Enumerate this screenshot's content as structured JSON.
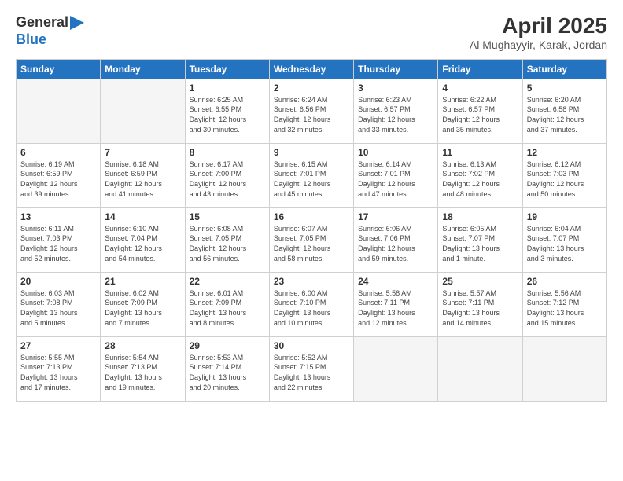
{
  "logo": {
    "line1": "General",
    "line2": "Blue"
  },
  "title": "April 2025",
  "subtitle": "Al Mughayyir, Karak, Jordan",
  "days_header": [
    "Sunday",
    "Monday",
    "Tuesday",
    "Wednesday",
    "Thursday",
    "Friday",
    "Saturday"
  ],
  "weeks": [
    [
      {
        "num": "",
        "info": ""
      },
      {
        "num": "",
        "info": ""
      },
      {
        "num": "1",
        "info": "Sunrise: 6:25 AM\nSunset: 6:55 PM\nDaylight: 12 hours\nand 30 minutes."
      },
      {
        "num": "2",
        "info": "Sunrise: 6:24 AM\nSunset: 6:56 PM\nDaylight: 12 hours\nand 32 minutes."
      },
      {
        "num": "3",
        "info": "Sunrise: 6:23 AM\nSunset: 6:57 PM\nDaylight: 12 hours\nand 33 minutes."
      },
      {
        "num": "4",
        "info": "Sunrise: 6:22 AM\nSunset: 6:57 PM\nDaylight: 12 hours\nand 35 minutes."
      },
      {
        "num": "5",
        "info": "Sunrise: 6:20 AM\nSunset: 6:58 PM\nDaylight: 12 hours\nand 37 minutes."
      }
    ],
    [
      {
        "num": "6",
        "info": "Sunrise: 6:19 AM\nSunset: 6:59 PM\nDaylight: 12 hours\nand 39 minutes."
      },
      {
        "num": "7",
        "info": "Sunrise: 6:18 AM\nSunset: 6:59 PM\nDaylight: 12 hours\nand 41 minutes."
      },
      {
        "num": "8",
        "info": "Sunrise: 6:17 AM\nSunset: 7:00 PM\nDaylight: 12 hours\nand 43 minutes."
      },
      {
        "num": "9",
        "info": "Sunrise: 6:15 AM\nSunset: 7:01 PM\nDaylight: 12 hours\nand 45 minutes."
      },
      {
        "num": "10",
        "info": "Sunrise: 6:14 AM\nSunset: 7:01 PM\nDaylight: 12 hours\nand 47 minutes."
      },
      {
        "num": "11",
        "info": "Sunrise: 6:13 AM\nSunset: 7:02 PM\nDaylight: 12 hours\nand 48 minutes."
      },
      {
        "num": "12",
        "info": "Sunrise: 6:12 AM\nSunset: 7:03 PM\nDaylight: 12 hours\nand 50 minutes."
      }
    ],
    [
      {
        "num": "13",
        "info": "Sunrise: 6:11 AM\nSunset: 7:03 PM\nDaylight: 12 hours\nand 52 minutes."
      },
      {
        "num": "14",
        "info": "Sunrise: 6:10 AM\nSunset: 7:04 PM\nDaylight: 12 hours\nand 54 minutes."
      },
      {
        "num": "15",
        "info": "Sunrise: 6:08 AM\nSunset: 7:05 PM\nDaylight: 12 hours\nand 56 minutes."
      },
      {
        "num": "16",
        "info": "Sunrise: 6:07 AM\nSunset: 7:05 PM\nDaylight: 12 hours\nand 58 minutes."
      },
      {
        "num": "17",
        "info": "Sunrise: 6:06 AM\nSunset: 7:06 PM\nDaylight: 12 hours\nand 59 minutes."
      },
      {
        "num": "18",
        "info": "Sunrise: 6:05 AM\nSunset: 7:07 PM\nDaylight: 13 hours\nand 1 minute."
      },
      {
        "num": "19",
        "info": "Sunrise: 6:04 AM\nSunset: 7:07 PM\nDaylight: 13 hours\nand 3 minutes."
      }
    ],
    [
      {
        "num": "20",
        "info": "Sunrise: 6:03 AM\nSunset: 7:08 PM\nDaylight: 13 hours\nand 5 minutes."
      },
      {
        "num": "21",
        "info": "Sunrise: 6:02 AM\nSunset: 7:09 PM\nDaylight: 13 hours\nand 7 minutes."
      },
      {
        "num": "22",
        "info": "Sunrise: 6:01 AM\nSunset: 7:09 PM\nDaylight: 13 hours\nand 8 minutes."
      },
      {
        "num": "23",
        "info": "Sunrise: 6:00 AM\nSunset: 7:10 PM\nDaylight: 13 hours\nand 10 minutes."
      },
      {
        "num": "24",
        "info": "Sunrise: 5:58 AM\nSunset: 7:11 PM\nDaylight: 13 hours\nand 12 minutes."
      },
      {
        "num": "25",
        "info": "Sunrise: 5:57 AM\nSunset: 7:11 PM\nDaylight: 13 hours\nand 14 minutes."
      },
      {
        "num": "26",
        "info": "Sunrise: 5:56 AM\nSunset: 7:12 PM\nDaylight: 13 hours\nand 15 minutes."
      }
    ],
    [
      {
        "num": "27",
        "info": "Sunrise: 5:55 AM\nSunset: 7:13 PM\nDaylight: 13 hours\nand 17 minutes."
      },
      {
        "num": "28",
        "info": "Sunrise: 5:54 AM\nSunset: 7:13 PM\nDaylight: 13 hours\nand 19 minutes."
      },
      {
        "num": "29",
        "info": "Sunrise: 5:53 AM\nSunset: 7:14 PM\nDaylight: 13 hours\nand 20 minutes."
      },
      {
        "num": "30",
        "info": "Sunrise: 5:52 AM\nSunset: 7:15 PM\nDaylight: 13 hours\nand 22 minutes."
      },
      {
        "num": "",
        "info": ""
      },
      {
        "num": "",
        "info": ""
      },
      {
        "num": "",
        "info": ""
      }
    ]
  ]
}
